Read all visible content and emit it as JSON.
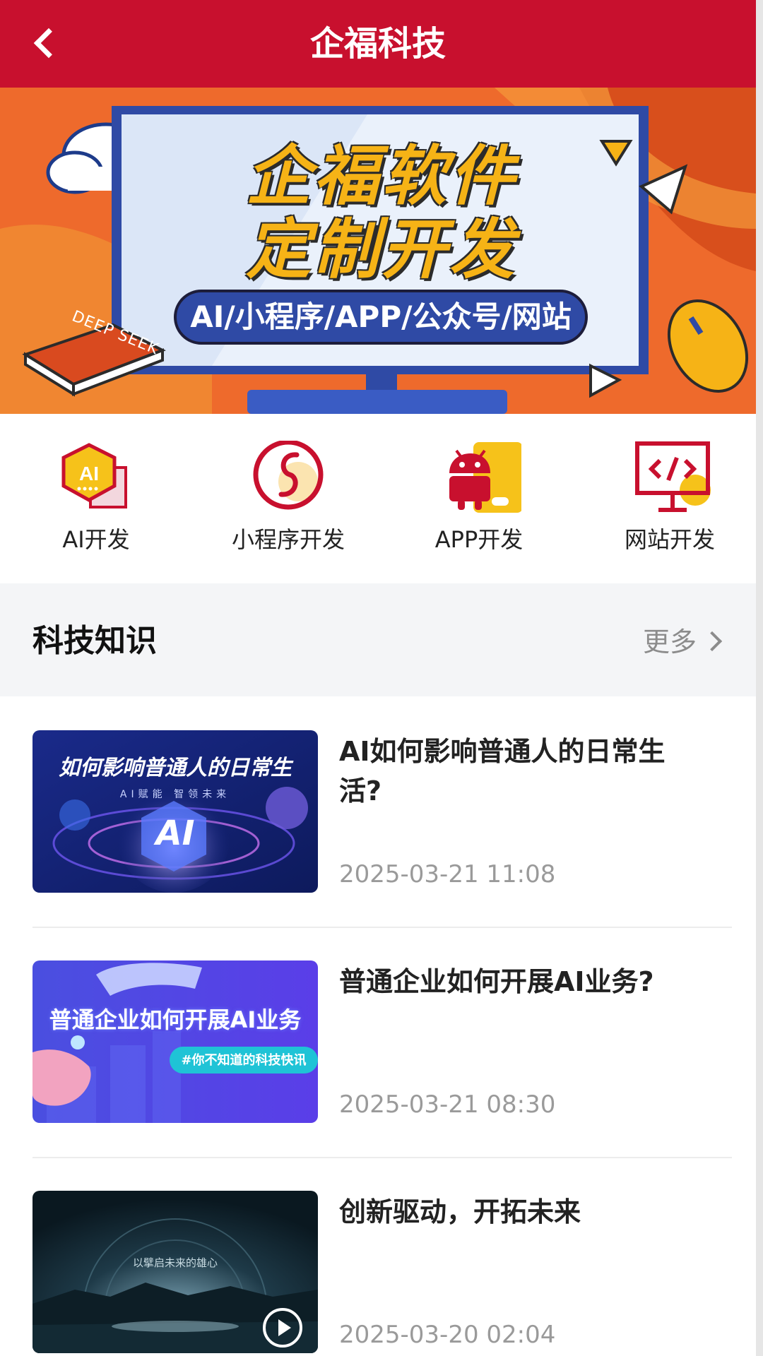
{
  "header": {
    "title": "企福科技"
  },
  "banner": {
    "title_line1": "企福软件",
    "title_line2": "定制开发",
    "tagline": "AI/小程序/APP/公众号/网站",
    "book_text": "DEEP SEEK"
  },
  "categories": [
    {
      "label": "AI开发",
      "icon": "ai-hexagon-icon"
    },
    {
      "label": "小程序开发",
      "icon": "mini-program-icon"
    },
    {
      "label": "APP开发",
      "icon": "android-icon"
    },
    {
      "label": "网站开发",
      "icon": "code-monitor-icon"
    }
  ],
  "section": {
    "title": "科技知识",
    "more_label": "更多"
  },
  "articles": [
    {
      "title": "AI如何影响普通人的日常生活?",
      "date": "2025-03-21 11:08",
      "thumb_caption": "如何影响普通人的日常生",
      "thumb_sub": "AI赋能 智领未来"
    },
    {
      "title": "普通企业如何开展AI业务?",
      "date": "2025-03-21 08:30",
      "thumb_caption": "普通企业如何开展AI业务",
      "thumb_sub": "#你不知道的科技快讯"
    },
    {
      "title": "创新驱动，开拓未来",
      "date": "2025-03-20 02:04",
      "thumb_caption": "以擘启未来的雄心"
    }
  ],
  "colors": {
    "brand_red": "#c8102e",
    "banner_orange": "#ee6a2c",
    "accent_yellow": "#f6b316"
  }
}
